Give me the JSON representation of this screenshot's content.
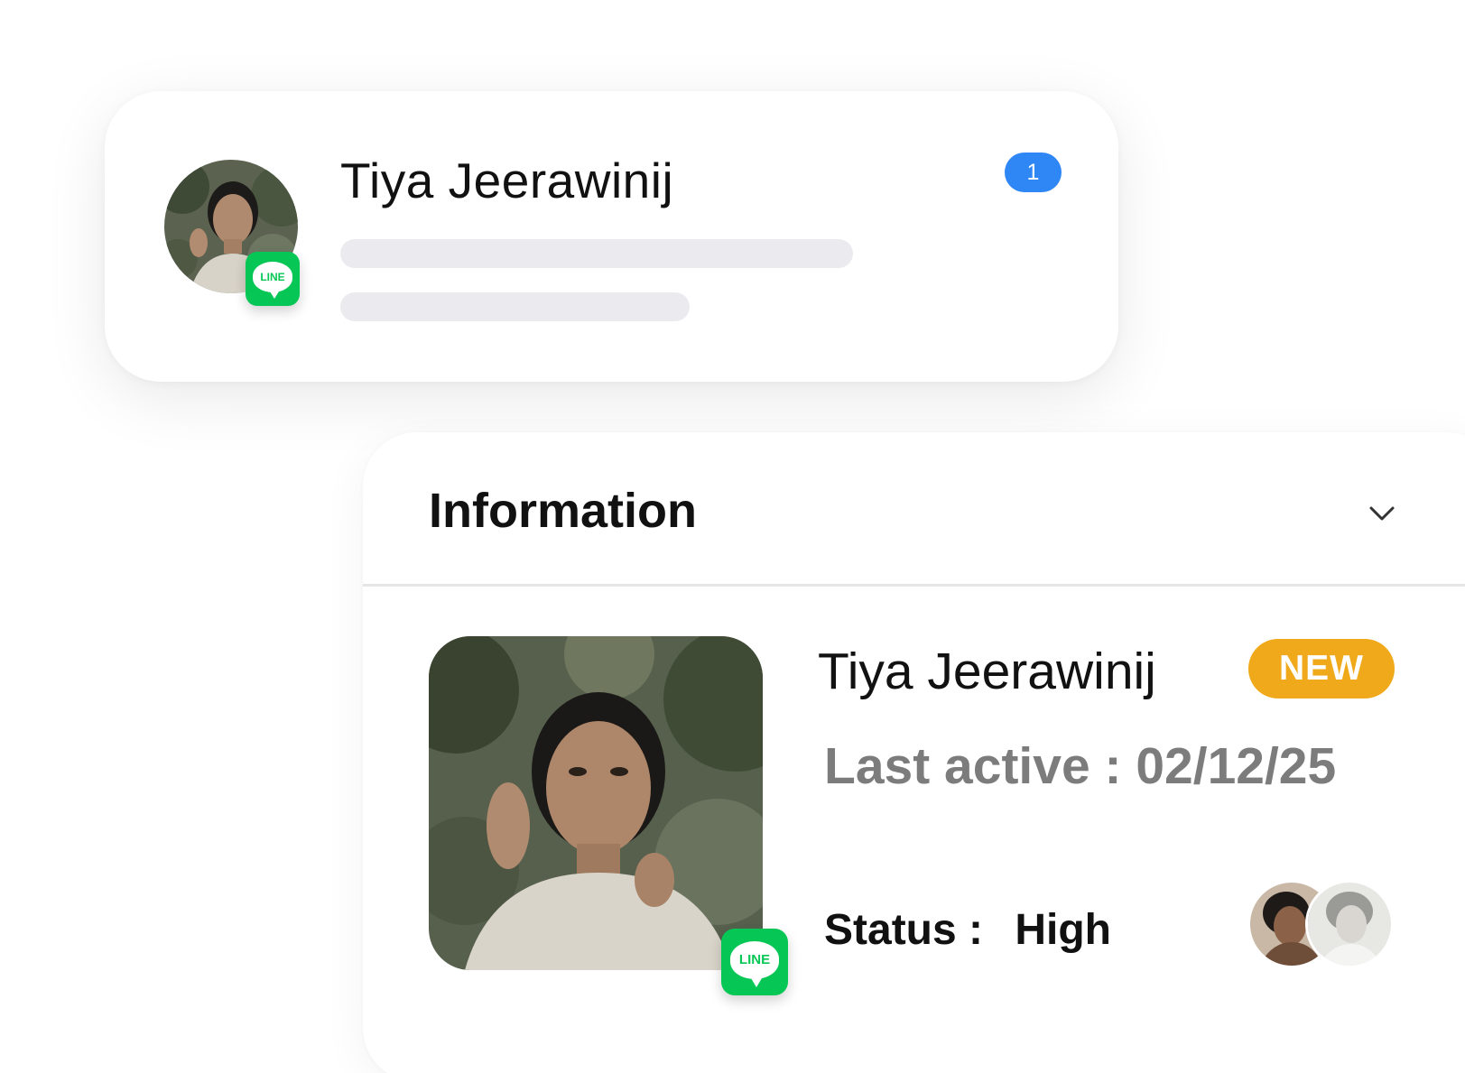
{
  "chat_card": {
    "contact_name": "Tiya Jeerawinij",
    "unread_count": "1",
    "channel_label": "LINE"
  },
  "info_panel": {
    "title": "Information",
    "profile": {
      "name": "Tiya Jeerawinij",
      "tag": "NEW",
      "last_active_label": "Last active :",
      "last_active_value": "02/12/25",
      "status_label": "Status :",
      "status_value": "High",
      "channel_label": "LINE"
    }
  },
  "colors": {
    "line_green": "#06c755",
    "unread_blue": "#2f86f5",
    "new_badge": "#f0a91a",
    "skeleton": "#ebebef",
    "muted_text": "#7c7c7c"
  }
}
